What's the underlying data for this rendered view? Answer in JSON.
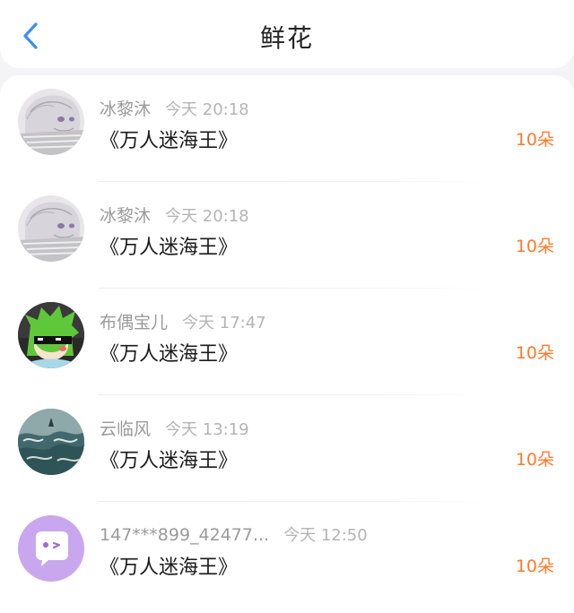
{
  "header": {
    "title": "鲜花",
    "back_icon": "chevron-left-icon",
    "accent_color": "#3a8ef0"
  },
  "records": [
    {
      "user": "冰黎沐",
      "time": "今天 20:18",
      "work": "《万人迷海王》",
      "count": "10朵",
      "avatar": "sketch-girl-avatar"
    },
    {
      "user": "冰黎沐",
      "time": "今天 20:18",
      "work": "《万人迷海王》",
      "count": "10朵",
      "avatar": "sketch-girl-avatar"
    },
    {
      "user": "布偶宝儿",
      "time": "今天 17:47",
      "work": "《万人迷海王》",
      "count": "10朵",
      "avatar": "green-hair-sunglasses-avatar"
    },
    {
      "user": "云临风",
      "time": "今天 13:19",
      "work": "《万人迷海王》",
      "count": "10朵",
      "avatar": "stormy-sea-avatar"
    },
    {
      "user": "147***899_42477...",
      "time": "今天 12:50",
      "work": "《万人迷海王》",
      "count": "10朵",
      "avatar": "default-chat-bubble-avatar"
    }
  ],
  "colors": {
    "count": "#ff7a29",
    "default_avatar_bg": "#c9a7ee"
  }
}
